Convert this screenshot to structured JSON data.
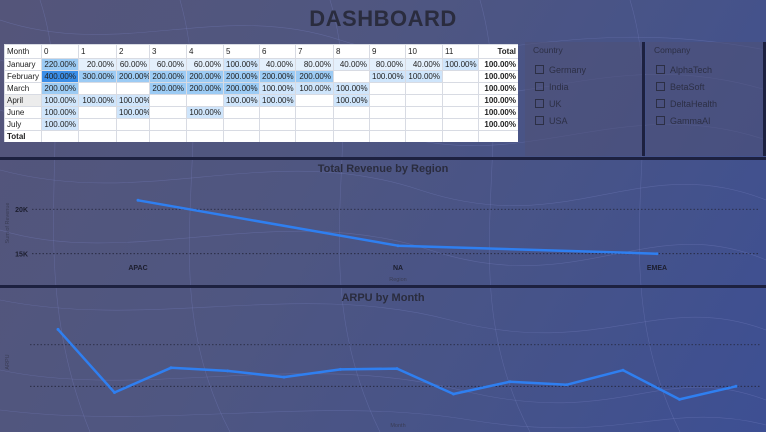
{
  "page": {
    "title": "DASHBOARD"
  },
  "matrix": {
    "header_label": "Month",
    "columns": [
      "0",
      "1",
      "2",
      "3",
      "4",
      "5",
      "6",
      "7",
      "8",
      "9",
      "10",
      "11"
    ],
    "total_label": "Total",
    "rows": [
      {
        "label": "January",
        "cells": [
          "220.00%",
          "20.00%",
          "60.00%",
          "60.00%",
          "60.00%",
          "100.00%",
          "40.00%",
          "80.00%",
          "40.00%",
          "80.00%",
          "40.00%",
          "100.00%"
        ],
        "total": "100.00%"
      },
      {
        "label": "February",
        "cells": [
          "400.00%",
          "300.00%",
          "200.00%",
          "200.00%",
          "200.00%",
          "200.00%",
          "200.00%",
          "200.00%",
          "",
          "100.00%",
          "100.00%",
          ""
        ],
        "total": "100.00%"
      },
      {
        "label": "March",
        "cells": [
          "200.00%",
          "",
          "",
          "200.00%",
          "200.00%",
          "200.00%",
          "100.00%",
          "100.00%",
          "100.00%",
          "",
          "",
          ""
        ],
        "total": "100.00%"
      },
      {
        "label": "April",
        "cells": [
          "100.00%",
          "100.00%",
          "100.00%",
          "",
          "",
          "100.00%",
          "100.00%",
          "",
          "100.00%",
          "",
          "",
          ""
        ],
        "total": "100.00%"
      },
      {
        "label": "June",
        "cells": [
          "100.00%",
          "",
          "100.00%",
          "",
          "100.00%",
          "",
          "",
          "",
          "",
          "",
          "",
          ""
        ],
        "total": "100.00%"
      },
      {
        "label": "July",
        "cells": [
          "100.00%",
          "",
          "",
          "",
          "",
          "",
          "",
          "",
          "",
          "",
          "",
          ""
        ],
        "total": "100.00%"
      }
    ],
    "grand_total_label": "Total",
    "colors": {
      "strong": "#3b8ee8",
      "medium": "#9ccbf4",
      "light": "#cfe5fb",
      "faint": "#e4f0fc"
    }
  },
  "slicers": {
    "country": {
      "title": "Country",
      "items": [
        "Germany",
        "India",
        "UK",
        "USA"
      ]
    },
    "company": {
      "title": "Company",
      "items": [
        "AlphaTech",
        "BetaSoft",
        "DeltaHealth",
        "GammaAI"
      ]
    }
  },
  "chart_data": [
    {
      "type": "line",
      "title": "Total Revenue by Region",
      "xlabel": "Region",
      "ylabel": "Sum of Revenue",
      "categories": [
        "APAC",
        "NA",
        "EMEA"
      ],
      "values": [
        21000,
        15900,
        15000
      ],
      "y_ticks": [
        "15K",
        "20K"
      ],
      "ylim": [
        13500,
        22500
      ],
      "color": "#2f7ff0"
    },
    {
      "type": "line",
      "title": "ARPU by Month",
      "xlabel": "Month",
      "ylabel": "ARPU",
      "values": [
        1000,
        590,
        750,
        730,
        690,
        740,
        745,
        580,
        660,
        640,
        735,
        545,
        630
      ],
      "ylim": [
        450,
        1100
      ],
      "color": "#2f7ff0"
    }
  ]
}
